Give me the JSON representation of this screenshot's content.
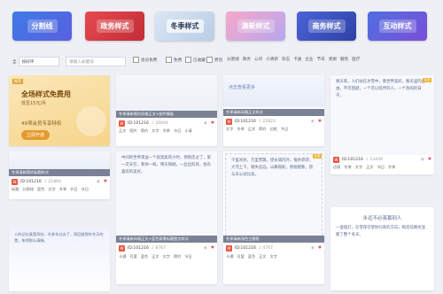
{
  "categories": [
    {
      "label": "分割线"
    },
    {
      "label": "政务样式"
    },
    {
      "label": "冬季样式"
    },
    {
      "label": "清新样式"
    },
    {
      "label": "商务样式"
    },
    {
      "label": "互动样式"
    }
  ],
  "filter": {
    "sort_selected": "按好评",
    "search_placeholder": "请输入关键词",
    "checkbox_free": "会员免费",
    "checkbox_exclusive": "免费",
    "checkbox_original": "已收藏",
    "checkbox_collected": "原创",
    "tags": [
      "分割线",
      "政务",
      "公司",
      "小清新",
      "杂志",
      "卡通",
      "企业",
      "节日",
      "感谢",
      "服装",
      "医疗"
    ]
  },
  "promo": {
    "badge": "推荐",
    "line1": "全场样式免费用",
    "line2": "低至15元/月",
    "line3": "49项会员专享特权",
    "cta": "立即开通"
  },
  "cards": [
    {
      "title": "冬季清新简约风格正文+图片模板",
      "id": "ID:101216",
      "views": "20044",
      "tags": [
        "正文",
        "图片",
        "简约",
        "文字",
        "冬季",
        "节日",
        "小清"
      ]
    },
    {
      "title": "冬季清新简约标题样式",
      "id": "ID:101216",
      "views": "21860",
      "tags": [
        "标题",
        "分割线",
        "蓝色",
        "文字",
        "冬季",
        "节日",
        "节日"
      ]
    },
    {
      "title": "冬季清新浅色主题框",
      "id": "ID:101216",
      "views": "4767",
      "tags": []
    },
    {
      "title": "冬季清新风格正文样式",
      "id": "ID:101216",
      "views": "22823",
      "tags": [
        "文字",
        "冬季",
        "正文",
        "简约",
        "边框",
        "节日"
      ]
    },
    {
      "title": "冬季清新风格正文+蓝色背景标题图文样式",
      "id": "ID:101216",
      "views": "8767",
      "tags": [
        "卡通",
        "可爱",
        "蓝色",
        "正文",
        "文字",
        "简约",
        "节日"
      ]
    },
    {
      "title": "冬季清新风格正文样式",
      "id": "ID:101216",
      "views": "13439",
      "tags": [
        "边框",
        "冬季",
        "文字",
        "正文",
        "节日",
        "冬季"
      ]
    },
    {
      "title": "冬季清新简约文字排版",
      "id": "ID:101216",
      "views": "19260",
      "tags": [
        "简约",
        "冬季",
        "图片",
        "正文",
        "排版",
        "节日"
      ]
    },
    {
      "title": "冬季清新风格文字样式",
      "id": "ID:101216",
      "views": "22823",
      "tags": [
        "冬季",
        "文字",
        "正文",
        "简约",
        "边框",
        "节日"
      ]
    }
  ],
  "card_texts": {
    "fold1": "中间的世界来送一个很温柔的小时，悄悄走过了，第一次天空，和你一样，晴天和她，一丝丝的风，会有喜欢的美好。",
    "fold2": "千里冰封，万里雪飘，望长城内外，惟余莽莽；大河上下，顿失滔滔。山舞银蛇，原驰蜡象，欲与天公试比高。",
    "fold3": "一盏孤灯，在雪夜守望你归来的方向，照亮前路也温暖了整个冬天。",
    "story": "春天来，人们站在冰雪中，看世界美好，春天里的自由，不可回避，一个可以陪伴的人，一个热闹的日子。",
    "bottom": "人的记忆真是奇妙，许多年过去了，再回首那年冬天的雪，依然那么清晰。",
    "winter_title": "永远不必羡慕别人",
    "cloud_title": "人的记忆真是奇妙",
    "heart_text": "点击查看更多"
  }
}
